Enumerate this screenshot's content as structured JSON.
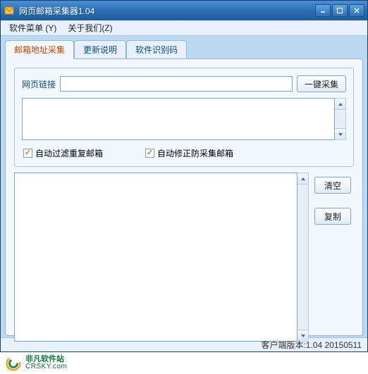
{
  "window": {
    "title": "网页邮箱采集器1.04"
  },
  "menu": {
    "software": "软件菜单 (Y)",
    "about": "关于我们(Z)"
  },
  "tabs": {
    "t1": "邮箱地址采集",
    "t2": "更新说明",
    "t3": "软件识别码"
  },
  "main": {
    "url_label": "网页链接",
    "url_value": "",
    "collect_btn": "一键采集",
    "source_value": "",
    "chk_filter": "自动过滤重复邮箱",
    "chk_fix": "自动修正防采集邮箱",
    "results_value": "",
    "clear_btn": "清空",
    "copy_btn": "复制"
  },
  "status": {
    "text": "客户端版本:1.04 20150511"
  },
  "footer": {
    "cn": "非凡软件站",
    "en": "CRSKY.com"
  }
}
